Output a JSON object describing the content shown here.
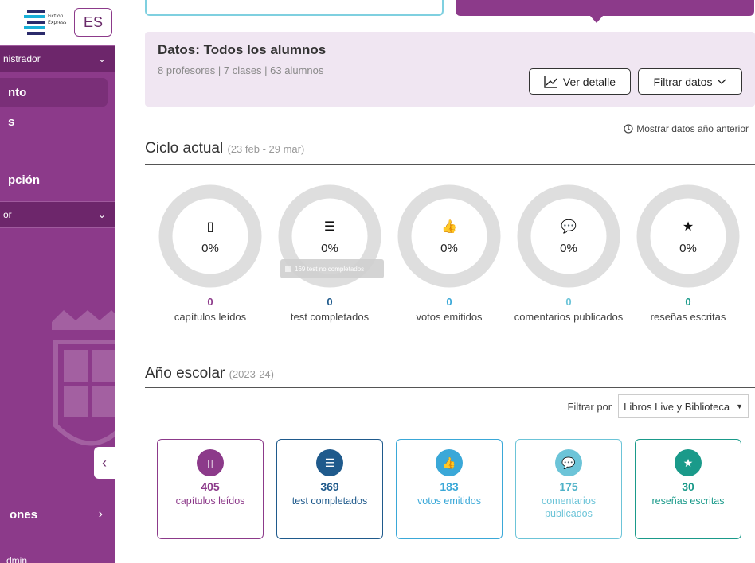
{
  "sidebar": {
    "lang": "ES",
    "role_dropdown": "nistrador",
    "items": [
      {
        "label": "nto"
      },
      {
        "label": "s"
      },
      {
        "label": "pción"
      }
    ],
    "second_dropdown": "or",
    "bottom_item": "ones",
    "admin_label": "dmin"
  },
  "header": {
    "title": "Datos: Todos los alumnos",
    "subtitle": "8 profesores | 7 clases | 63 alumnos",
    "detail_button": "Ver detalle",
    "filter_button": "Filtrar datos"
  },
  "prev_year_link": "Mostrar datos año anterior",
  "cycle": {
    "title": "Ciclo actual",
    "range": "(23 feb - 29 mar)",
    "tooltip": "169 test no completados",
    "stats": [
      {
        "icon": "tablet-icon",
        "glyph": "▯",
        "percent": "0%",
        "value": "0",
        "label": "capítulos leídos",
        "color": "#8c3a8a"
      },
      {
        "icon": "list-icon",
        "glyph": "☰",
        "percent": "0%",
        "value": "0",
        "label": "test completados",
        "color": "#1f5a8c"
      },
      {
        "icon": "thumbs-up-icon",
        "glyph": "👍",
        "percent": "0%",
        "value": "0",
        "label": "votos emitidos",
        "color": "#3aa8d8"
      },
      {
        "icon": "comments-icon",
        "glyph": "💬",
        "percent": "0%",
        "value": "0",
        "label": "comentarios publicados",
        "color": "#6cc4d8"
      },
      {
        "icon": "star-review-icon",
        "glyph": "★",
        "percent": "0%",
        "value": "0",
        "label": "reseñas escritas",
        "color": "#1a9a8a"
      }
    ]
  },
  "school_year": {
    "title": "Año escolar",
    "range": "(2023-24)",
    "filter_label": "Filtrar por",
    "filter_value": "Libros Live y Biblioteca",
    "cards": [
      {
        "icon": "tablet-icon",
        "glyph": "▯",
        "value": "405",
        "label": "capítulos leídos",
        "color": "#8c3a8a"
      },
      {
        "icon": "list-icon",
        "glyph": "☰",
        "value": "369",
        "label": "test completados",
        "color": "#1f5a8c"
      },
      {
        "icon": "thumbs-up-icon",
        "glyph": "👍",
        "value": "183",
        "label": "votos emitidos",
        "color": "#3aa8d8"
      },
      {
        "icon": "comments-icon",
        "glyph": "💬",
        "value": "175",
        "label": "comentarios publicados",
        "color": "#6cc4d8"
      },
      {
        "icon": "star-review-icon",
        "glyph": "★",
        "value": "30",
        "label": "reseñas escritas",
        "color": "#1a9a8a"
      }
    ]
  }
}
